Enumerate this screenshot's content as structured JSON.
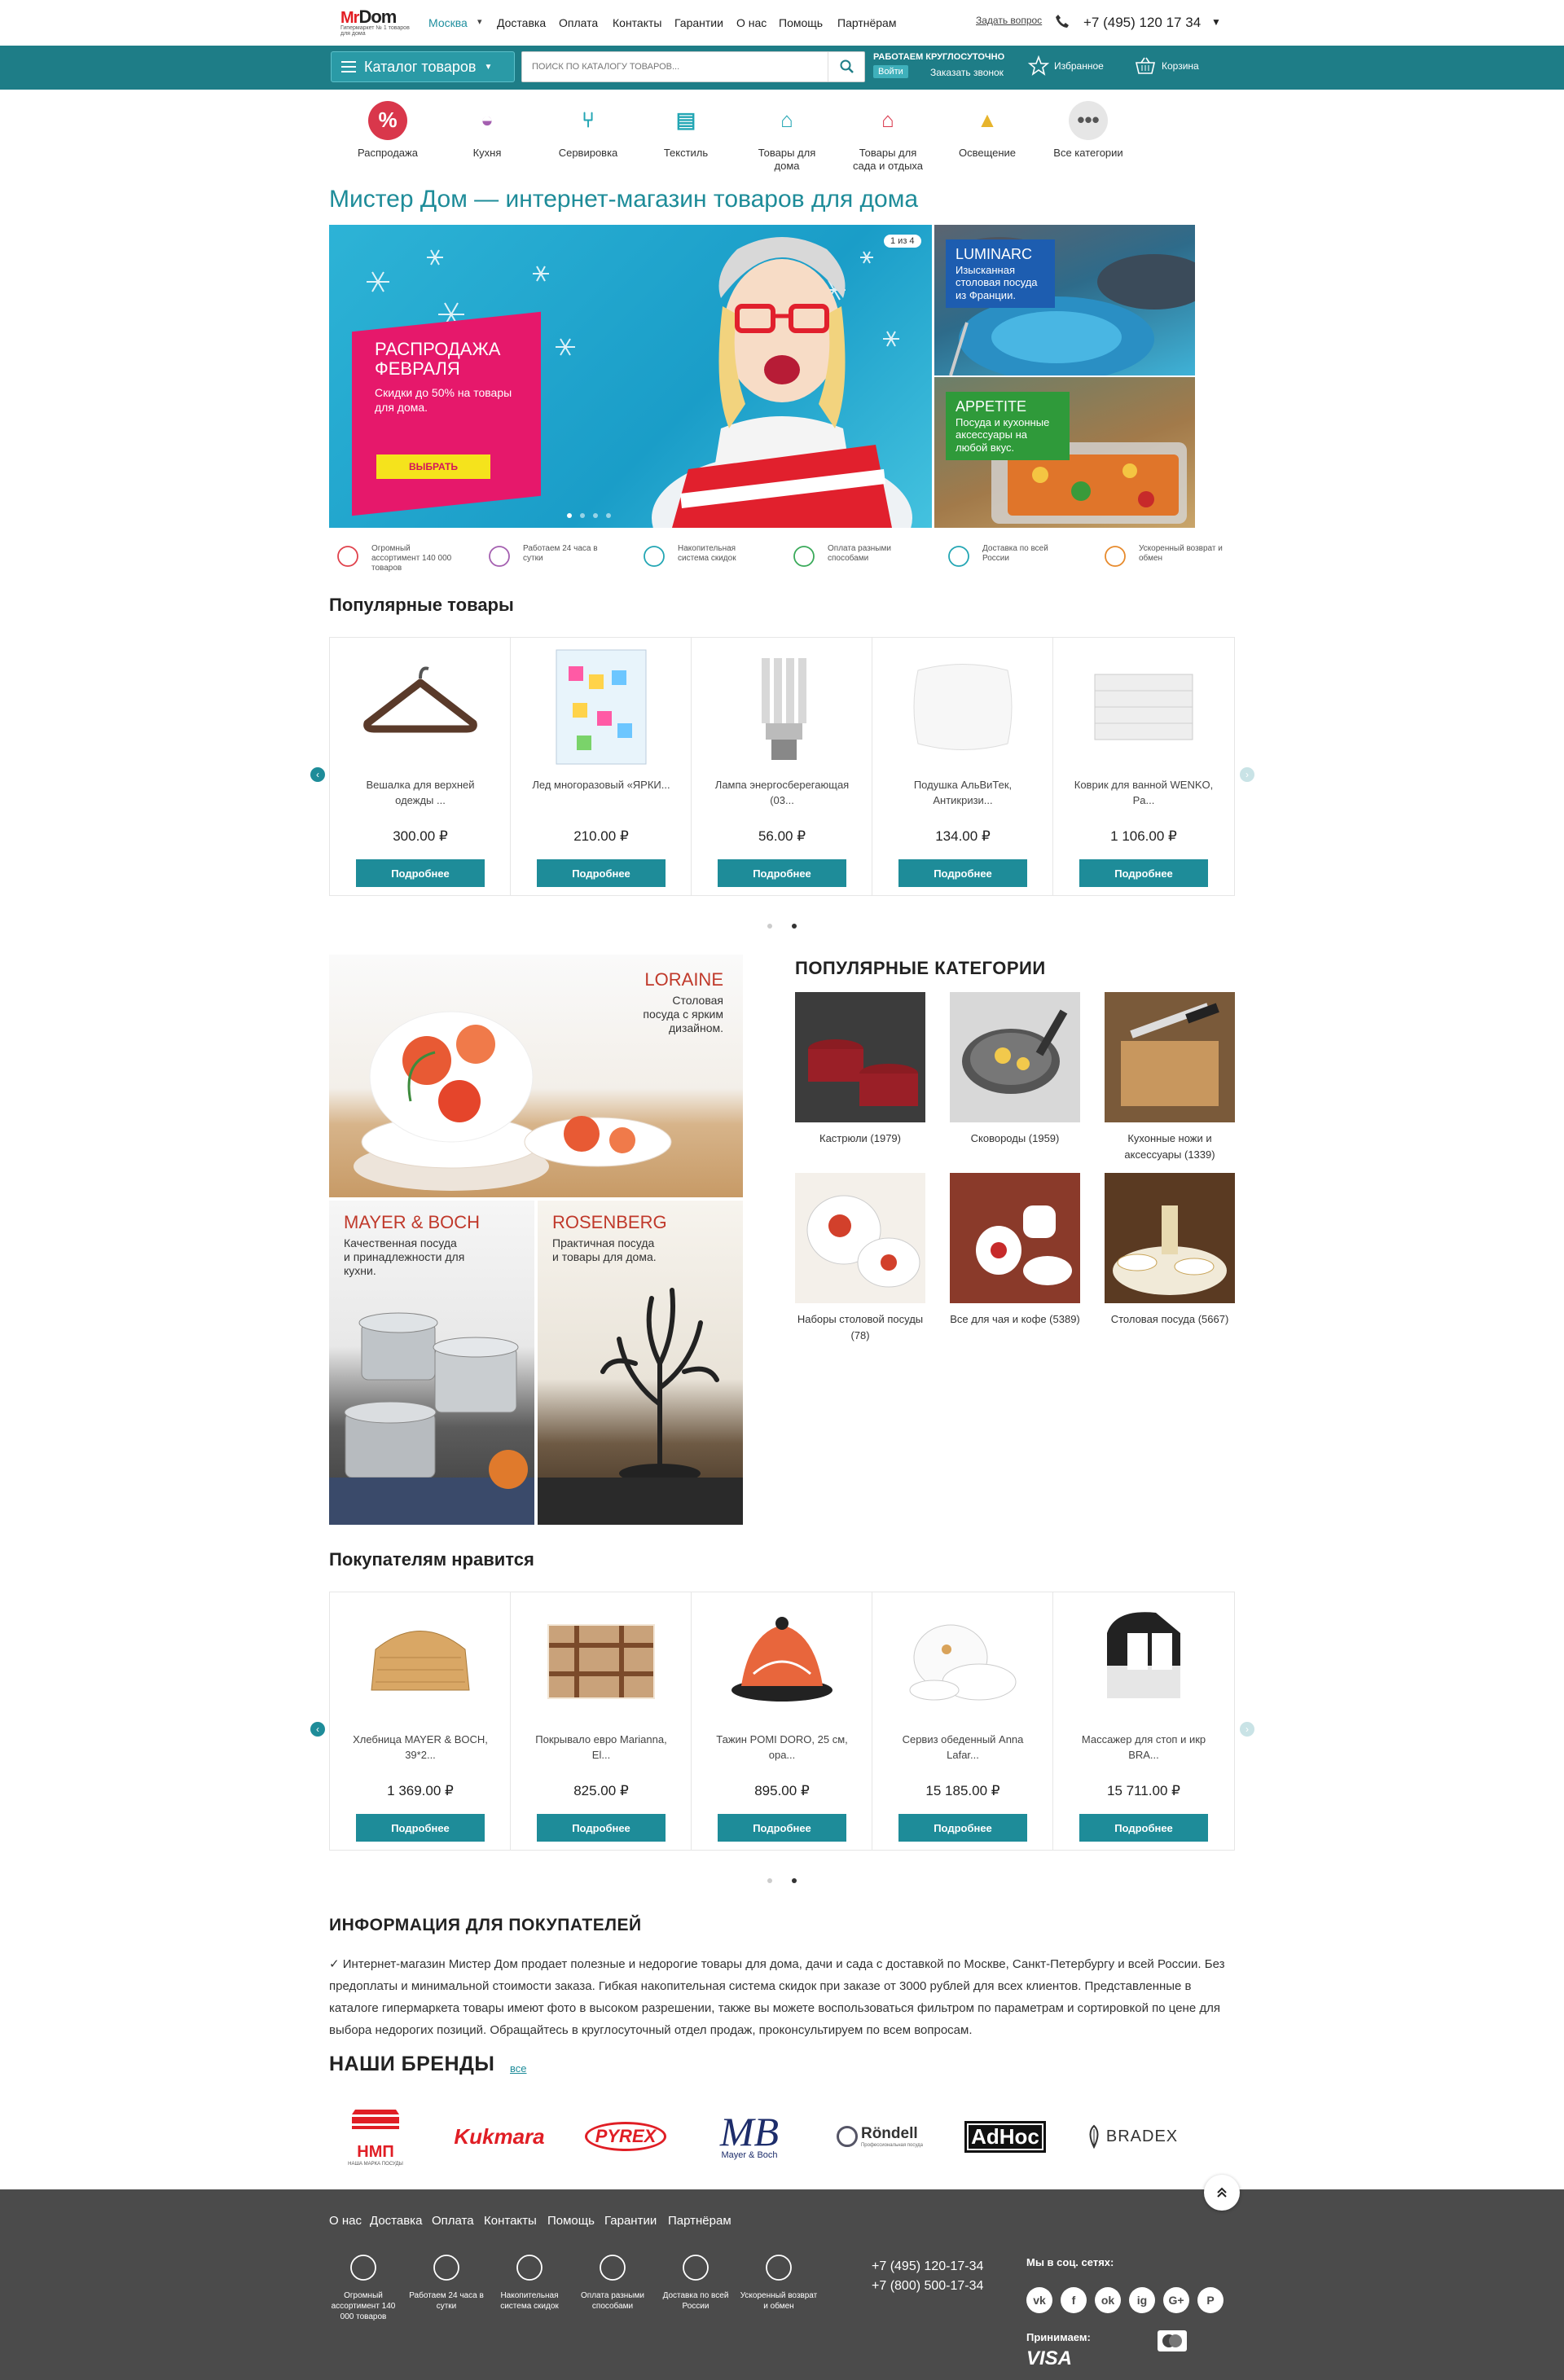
{
  "header": {
    "logo_mr": "Mr",
    "logo_dom": "Dom",
    "logo_tagline": "Гипермаркет № 1 товаров для дома",
    "city": "Москва",
    "nav": [
      "Доставка",
      "Оплата",
      "Контакты",
      "Гарантии",
      "О нас",
      "Помощь",
      "Партнёрам"
    ],
    "ask_question": "Задать вопрос",
    "phone": "+7 (495) 120 17 34"
  },
  "toolbar": {
    "catalog_label": "Каталог товаров",
    "search_placeholder": "ПОИСК ПО КАТАЛОГУ ТОВАРОВ...",
    "open_24": "РАБОТАЕМ КРУГЛОСУТОЧНО",
    "login": "Войти",
    "callback": "Заказать звонок",
    "favorites": "Избранное",
    "cart": "Корзина"
  },
  "categories": [
    {
      "label": "Распродажа",
      "icon": "sale-icon",
      "color": "#d9374b"
    },
    {
      "label": "Кухня",
      "icon": "pot-icon",
      "color": "#a45fb0"
    },
    {
      "label": "Сервировка",
      "icon": "cutlery-icon",
      "color": "#23a6b4"
    },
    {
      "label": "Текстиль",
      "icon": "textile-icon",
      "color": "#23a6b4"
    },
    {
      "label": "Товары для дома",
      "icon": "house-icon",
      "color": "#23a6b4"
    },
    {
      "label": "Товары для сада и отдыха",
      "icon": "garden-house-icon",
      "color": "#d9374b"
    },
    {
      "label": "Освещение",
      "icon": "lamp-icon",
      "color": "#e7b42c"
    },
    {
      "label": "Все категории",
      "icon": "more-icon",
      "color": "#555555"
    }
  ],
  "page_title": "Мистер Дом — интернет-магазин товаров для дома",
  "hero": {
    "promo_title": "РАСПРОДАЖА ФЕВРАЛЯ",
    "promo_sub": "Скидки до 50% на товары для дома.",
    "promo_button": "ВЫБРАТЬ",
    "slide_counter": "1 из 4",
    "side1_title": "LUMINARC",
    "side1_text": "Изысканная столовая посуда из Франции.",
    "side2_title": "APPETITE",
    "side2_text": "Посуда и кухонные аксессуары на любой вкус."
  },
  "advantages": [
    {
      "text": "Огромный ассортимент 140 000 товаров",
      "icon": "bag-icon",
      "color": "#e0424c"
    },
    {
      "text": "Работаем 24 часа в сутки",
      "icon": "clock-check-icon",
      "color": "#a45fb0"
    },
    {
      "text": "Накопительная система скидок",
      "icon": "percent-icon",
      "color": "#23a6b4"
    },
    {
      "text": "Оплата разными способами",
      "icon": "cards-icon",
      "color": "#3aaa5a"
    },
    {
      "text": "Доставка по всей России",
      "icon": "truck-icon",
      "color": "#23a6b4"
    },
    {
      "text": "Ускоренный возврат и обмен",
      "icon": "refresh-icon",
      "color": "#e78a2c"
    }
  ],
  "popular_products": {
    "title": "Популярные товары",
    "items": [
      {
        "name": "Вешалка для верхней одежды ...",
        "price": "300.00 ₽",
        "button": "Подробнее"
      },
      {
        "name": "Лед многоразовый «ЯРКИ...",
        "price": "210.00 ₽",
        "button": "Подробнее"
      },
      {
        "name": "Лампа энергосберегающая (03...",
        "price": "56.00 ₽",
        "button": "Подробнее"
      },
      {
        "name": "Подушка АльВиТек, Антикризи...",
        "price": "134.00 ₽",
        "button": "Подробнее"
      },
      {
        "name": "Коврик для ванной WENKO, Pa...",
        "price": "1 106.00 ₽",
        "button": "Подробнее"
      }
    ]
  },
  "brand_banners": {
    "b1_title": "LORAINE",
    "b1_text": "Столовая посуда с ярким дизайном.",
    "b2_title": "MAYER & BOCH",
    "b2_text": "Качественная посуда и принадлежности для кухни.",
    "b3_title": "ROSENBERG",
    "b3_text": "Практичная посуда и товары для дома."
  },
  "popular_categories": {
    "title": "ПОПУЛЯРНЫЕ КАТЕГОРИИ",
    "items": [
      {
        "label": "Кастрюли (1979)"
      },
      {
        "label": "Сковороды (1959)"
      },
      {
        "label": "Кухонные ножи и аксессуары (1339)"
      },
      {
        "label": "Наборы столовой посуды (78)"
      },
      {
        "label": "Все для чая и кофе (5389)"
      },
      {
        "label": "Столовая посуда (5667)"
      }
    ]
  },
  "liked_products": {
    "title": "Покупателям нравится",
    "items": [
      {
        "name": "Хлебница MAYER & BOCH, 39*2...",
        "price": "1 369.00 ₽",
        "button": "Подробнее"
      },
      {
        "name": "Покрывало евро Marianna, El...",
        "price": "825.00 ₽",
        "button": "Подробнее"
      },
      {
        "name": "Тажин POMI DORO, 25 см, ора...",
        "price": "895.00 ₽",
        "button": "Подробнее"
      },
      {
        "name": "Сервиз обеденный Anna Lafar...",
        "price": "15 185.00 ₽",
        "button": "Подробнее"
      },
      {
        "name": "Массажер для стоп и икр BRA...",
        "price": "15 711.00 ₽",
        "button": "Подробнее"
      }
    ]
  },
  "info": {
    "title": "ИНФОРМАЦИЯ ДЛЯ ПОКУПАТЕЛЕЙ",
    "text": "✓ Интернет-магазин Мистер Дом продает полезные и недорогие товары для дома, дачи и сада с доставкой по Москве, Санкт-Петербургу и всей России. Без предоплаты и минимальной стоимости заказа. Гибкая накопительная система скидок при заказе от 3000 рублей для всех клиентов. Представленные в каталоге гипермаркета товары имеют фото в высоком разрешении, также вы можете воспользоваться фильтром по параметрам и сортировкой по цене для выбора недорогих позиций. Обращайтесь в круглосуточный отдел продаж, проконсультируем по всем вопросам."
  },
  "brands": {
    "title": "НАШИ БРЕНДЫ",
    "all": "все",
    "items": [
      "НМП",
      "Kukmara",
      "PYREX",
      "MB",
      "Röndell",
      "AdHoc",
      "BRADEX"
    ],
    "nmp_sub": "НАША МАРКА ПОСУДЫ",
    "mb_sub": "Mayer & Boch",
    "rondell_sub": "Профессиональная посуда"
  },
  "footer": {
    "links": [
      "О нас",
      "Доставка",
      "Оплата",
      "Контакты",
      "Помощь",
      "Гарантии",
      "Партнёрам"
    ],
    "advantages": [
      "Огромный ассортимент 140 000 товаров",
      "Работаем 24 часа в сутки",
      "Накопительная система скидок",
      "Оплата разными способами",
      "Доставка по всей России",
      "Ускоренный возврат и обмен"
    ],
    "phone1": "+7 (495) 120-17-34",
    "phone2": "+7 (800) 500-17-34",
    "social_title": "Мы в соц. сетях:",
    "social": [
      "vk-icon",
      "facebook-icon",
      "odnoklassniki-icon",
      "instagram-icon",
      "google-plus-icon",
      "pinterest-icon"
    ],
    "social_letters": [
      "vk",
      "f",
      "ok",
      "ig",
      "G+",
      "P"
    ],
    "accept_title": "Принимаем:",
    "visa": "VISA"
  }
}
